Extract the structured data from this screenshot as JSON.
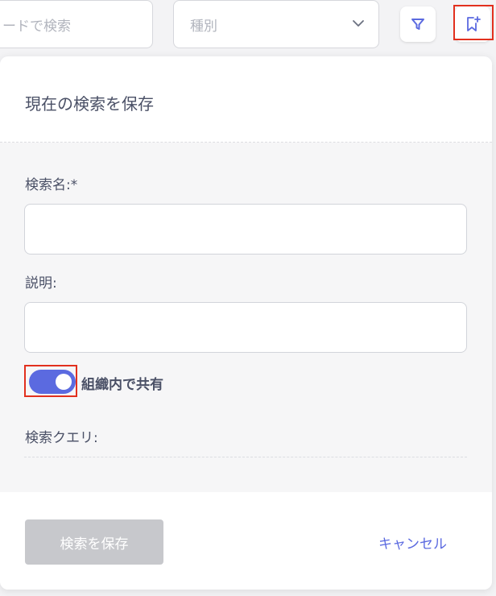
{
  "toolbar": {
    "keyword_placeholder": "ードで検索",
    "type_select_value": "種別"
  },
  "save_search_panel": {
    "title": "現在の検索を保存",
    "name_label": "検索名:*",
    "name_value": "",
    "description_label": "説明:",
    "description_value": "",
    "share_toggle": {
      "label": "組織内で共有",
      "on": true
    },
    "query_label": "検索クエリ:",
    "save_button_label": "検索を保存",
    "cancel_button_label": "キャンセル"
  },
  "colors": {
    "accent": "#5b6ae0",
    "disabled_button": "#c7c8cc",
    "highlight_box": "#e2301e",
    "text": "#4a5066"
  },
  "icons": {
    "filter": "filter-icon",
    "bookmark_add": "bookmark-add-icon",
    "chevron": "chevron-down-icon"
  }
}
